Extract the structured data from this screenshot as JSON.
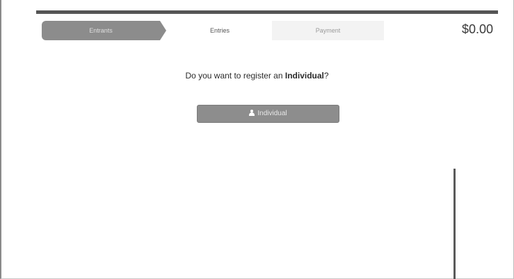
{
  "steps": [
    {
      "label": "Entrants",
      "state": "active"
    },
    {
      "label": "Entries",
      "state": "pending"
    },
    {
      "label": "Payment",
      "state": "pending"
    }
  ],
  "total": "$0.00",
  "prompt": {
    "prefix": "Do you want to register an ",
    "emphasis": "Individual",
    "suffix": "?"
  },
  "individual_button": {
    "icon": "user-icon",
    "label": "Individual"
  },
  "colors": {
    "active_step": "#8c8c8c",
    "button": "#8d8d8d",
    "top_bar": "#555555"
  }
}
